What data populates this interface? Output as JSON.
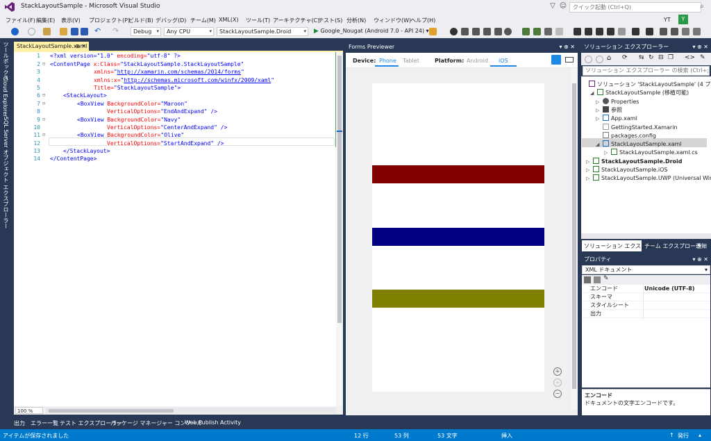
{
  "window": {
    "title": "StackLayoutSample - Microsoft Visual Studio",
    "quick_launch_placeholder": "クイック起動 (Ctrl+Q)",
    "user_initials": "YT",
    "user_badge": "Y"
  },
  "menu": [
    "ファイル(F)",
    "編集(E)",
    "表示(V)",
    "プロジェクト(P)",
    "ビルド(B)",
    "デバッグ(D)",
    "チーム(M)",
    "XML(X)",
    "ツール(T)",
    "アーキテクチャ(C)",
    "テスト(S)",
    "分析(N)",
    "ウィンドウ(W)",
    "ヘルプ(H)"
  ],
  "toolbar": {
    "config": "Debug",
    "platform": "Any CPU",
    "startup_project": "StackLayoutSample.Droid",
    "run_target": "Google_Nougat (Android 7.0 - API 24)"
  },
  "left_dock_tabs": [
    "ツールボックス",
    "Cloud Explorer",
    "SQL Server オブジェクト エクスプローラー"
  ],
  "editor": {
    "tab_label": "StackLayoutSample.xaml",
    "tab_icons": "⊕ ✕",
    "zoom": "100 %",
    "line_numbers": [
      "1",
      "2",
      "3",
      "4",
      "5",
      "6",
      "7",
      "8",
      "9",
      "10",
      "11",
      "12",
      "13",
      "14"
    ],
    "code": {
      "l1a": "<?xml version=",
      "l1b": "\"1.0\"",
      "l1c": " encoding=",
      "l1d": "\"utf-8\"",
      "l1e": " ?>",
      "l2a": "<ContentPage",
      "l2b": " x:Class=",
      "l2c": "\"StackLayoutSample.StackLayoutSample\"",
      "l3a": "xmlns=",
      "l3b": "\"",
      "l3c": "http://xamarin.com/schemas/2014/forms",
      "l3d": "\"",
      "l4a": "xmlns:x=",
      "l4b": "\"",
      "l4c": "http://schemas.microsoft.com/winfx/2009/xaml",
      "l4d": "\"",
      "l5a": "Title=",
      "l5b": "\"StackLayoutSample\"",
      "l5c": ">",
      "l6a": "<StackLayout",
      "l6b": ">",
      "l7a": "<BoxView",
      "l7b": " BackgroundColor=",
      "l7c": "\"Maroon\"",
      "l8a": "VerticalOptions=",
      "l8b": "\"EndAndExpand\"",
      "l8c": " />",
      "l9a": "<BoxView",
      "l9b": " BackgroundColor=",
      "l9c": "\"Navy\"",
      "l10a": "VerticalOptions=",
      "l10b": "\"CenterAndExpand\"",
      "l10c": " />",
      "l11a": "<BoxView",
      "l11b": " BackgroundColor=",
      "l11c": "\"Olive\"",
      "l12a": "VerticalOptions=",
      "l12b": "\"StartAndExpand\"",
      "l12c": " />",
      "l13a": "</StackLayout",
      "l13b": ">",
      "l14a": "</ContentPage",
      "l14b": ">"
    }
  },
  "forms_previewer": {
    "title": "Forms Previewer",
    "device_label": "Device:",
    "device_options": [
      "Phone",
      "Tablet"
    ],
    "platform_label": "Platform:",
    "platform_options": [
      "Android",
      "iOS"
    ],
    "selected_device": "Phone",
    "selected_platform": "iOS",
    "box_colors": {
      "maroon": "#800000",
      "navy": "#000080",
      "olive": "#808000"
    },
    "zoom_in": "+",
    "zoom_reset": "+",
    "zoom_out": "−"
  },
  "solution_explorer": {
    "title": "ソリューション エクスプローラー",
    "search_placeholder": "ソリューション エクスプローラー の検索 (Ctrl+;)",
    "items": [
      "ソリューション 'StackLayoutSample' (4 プロジェクト)",
      "StackLayoutSample (移植可能)",
      "Properties",
      "参照",
      "App.xaml",
      "GettingStarted.Xamarin",
      "packages.config",
      "StackLayoutSample.xaml",
      "StackLayoutSample.xaml.cs",
      "StackLayoutSample.Droid",
      "StackLayoutSample.iOS",
      "StackLayoutSample.UWP (Universal Windows)"
    ],
    "tabs": [
      "ソリューション エクスプロー...",
      "チーム エクスプローラー",
      "通知"
    ]
  },
  "properties": {
    "title": "プロパティ",
    "object": "XML ドキュメント",
    "rows": [
      {
        "key": "エンコード",
        "value": "Unicode (UTF-8)"
      },
      {
        "key": "スキーマ",
        "value": ""
      },
      {
        "key": "スタイルシート",
        "value": ""
      },
      {
        "key": "出力",
        "value": ""
      }
    ],
    "desc_title": "エンコード",
    "desc_text": "ドキュメントの文字エンコードです。"
  },
  "bottom_tabs": [
    "出力",
    "エラー一覧",
    "テスト エクスプローラー",
    "パッケージ マネージャー コンソール",
    "Web Publish Activity"
  ],
  "status": {
    "message": "アイテムが保存されました",
    "line": "12 行",
    "col": "53 列",
    "char": "53 文字",
    "mode": "挿入",
    "publish": "発行"
  }
}
